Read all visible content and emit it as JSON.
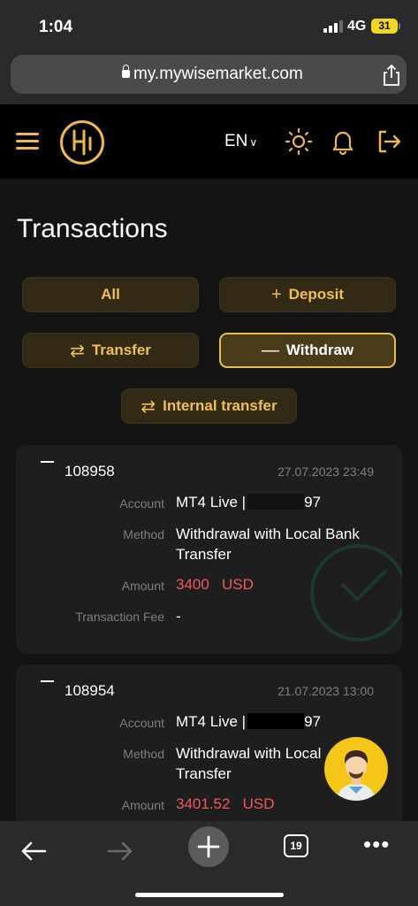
{
  "status_bar": {
    "time": "1:04",
    "network": "4G",
    "battery": "31"
  },
  "browser": {
    "url": "my.mywisemarket.com",
    "tabs_count": "19"
  },
  "header": {
    "language": "EN",
    "icons": [
      "menu-icon",
      "brand-logo",
      "sun-icon",
      "bell-icon",
      "logout-icon"
    ]
  },
  "page": {
    "title": "Transactions"
  },
  "filters": {
    "all": "All",
    "deposit": "Deposit",
    "transfer": "Transfer",
    "withdraw": "Withdraw",
    "internal_transfer": "Internal transfer",
    "active": "withdraw"
  },
  "transactions": [
    {
      "id": "108958",
      "date": "27.07.2023 23:49",
      "account_label": "Account",
      "account_prefix": "MT4 Live |",
      "account_suffix": "97",
      "method_label": "Method",
      "method_line1": "Withdrawal with Local Bank",
      "method_line2": "Transfer",
      "amount_label": "Amount",
      "amount_value": "3400",
      "amount_currency": "USD",
      "fee_label": "Transaction Fee",
      "fee_value": "-"
    },
    {
      "id": "108954",
      "date": "21.07.2023 13:00",
      "account_label": "Account",
      "account_prefix": "MT4 Live |",
      "account_suffix": "97",
      "method_label": "Method",
      "method_line1": "Withdrawal with Local",
      "method_line2": "Transfer",
      "amount_label": "Amount",
      "amount_value": "3401.52",
      "amount_currency": "USD"
    }
  ],
  "colors": {
    "accent": "#f0b84a",
    "amount_red": "#ee5a5a",
    "card_bg": "#1e1e1e",
    "background": "#141414"
  }
}
